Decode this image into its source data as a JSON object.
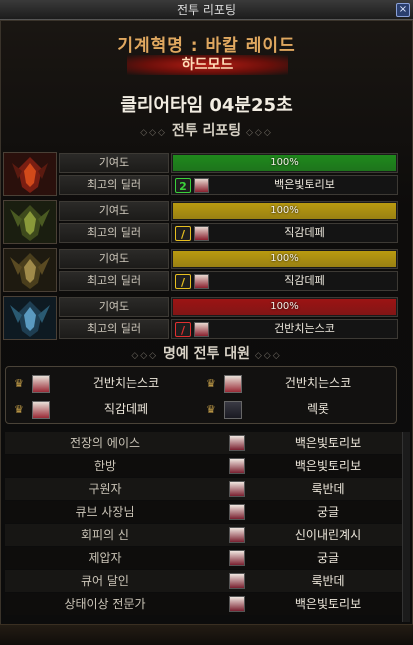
{
  "window": {
    "title": "전투 리포팅",
    "close_label": "×"
  },
  "raid": {
    "name": "기계혁명 : 바칼 레이드",
    "difficulty": "하드모드"
  },
  "clear_time": "클리어타임 04분25초",
  "sections": {
    "report": "전투 리포팅",
    "honor": "명예 전투 대원",
    "deco_left": "◇◇◇",
    "deco_right": "◇◇◇"
  },
  "labels": {
    "contribution": "기여도",
    "best_dealer": "최고의 딜러"
  },
  "colors": {
    "bar_green": "#1f8a1c",
    "bar_yellow": "#b99a10",
    "bar_red": "#9c1414",
    "accent": "#e0a860"
  },
  "reports": [
    {
      "boss_icon": "fire-dragon-icon",
      "contribution": "100%",
      "fill": 1.0,
      "bar_color": "#1f8a1c",
      "rank": "2",
      "rank_color": "#3bd13a",
      "dealer": "백은빛토리보"
    },
    {
      "boss_icon": "green-dragon-icon",
      "contribution": "100%",
      "fill": 1.0,
      "bar_color": "#b99a10",
      "rank": "/",
      "rank_color": "#e8c020",
      "dealer": "직감데페"
    },
    {
      "boss_icon": "gold-dragon-icon",
      "contribution": "100%",
      "fill": 1.0,
      "bar_color": "#b99a10",
      "rank": "/",
      "rank_color": "#e8c020",
      "dealer": "직감데페"
    },
    {
      "boss_icon": "ice-dragon-icon",
      "contribution": "100%",
      "fill": 1.0,
      "bar_color": "#9c1414",
      "rank": "/",
      "rank_color": "#e23030",
      "dealer": "건반치는스코"
    }
  ],
  "honor": [
    {
      "name": "건반치는스코"
    },
    {
      "name": "건반치는스코"
    },
    {
      "name": "직감데페"
    },
    {
      "name": "렉롯"
    }
  ],
  "awards": [
    {
      "title": "전장의 에이스",
      "name": "백은빛토리보"
    },
    {
      "title": "한방",
      "name": "백은빛토리보"
    },
    {
      "title": "구원자",
      "name": "룩반데"
    },
    {
      "title": "큐브 사장님",
      "name": "궁글"
    },
    {
      "title": "회피의 신",
      "name": "신이내린계시"
    },
    {
      "title": "제압자",
      "name": "궁글"
    },
    {
      "title": "큐어 달인",
      "name": "룩반데"
    },
    {
      "title": "상태이상 전문가",
      "name": "백은빛토리보"
    }
  ]
}
